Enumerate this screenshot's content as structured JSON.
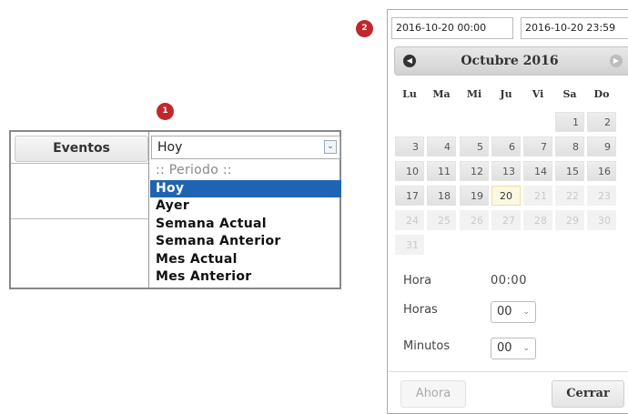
{
  "badges": {
    "one": "1",
    "two": "2"
  },
  "filter": {
    "eventos_label": "Eventos",
    "period_selected": "Hoy",
    "period_options": [
      "Periodo",
      "Hoy",
      "Ayer",
      "Semana Actual",
      "Semana Anterior",
      "Mes Actual",
      "Mes Anterior"
    ],
    "placeholder_display": ":: Periodo ::"
  },
  "datepicker": {
    "from_value": "2016-10-20 00:00",
    "to_value": "2016-10-20 23:59",
    "month_title": "Octubre 2016",
    "weekdays": [
      "Lu",
      "Ma",
      "Mi",
      "Ju",
      "Vi",
      "Sa",
      "Do"
    ],
    "prev_icon": "circle-arrow-left-icon",
    "next_icon": "circle-arrow-right-icon",
    "today": "20",
    "weeks": [
      [
        "",
        "",
        "",
        "",
        "",
        "1",
        "2"
      ],
      [
        "3",
        "4",
        "5",
        "6",
        "7",
        "8",
        "9"
      ],
      [
        "10",
        "11",
        "12",
        "13",
        "14",
        "15",
        "16"
      ],
      [
        "17",
        "18",
        "19",
        "20",
        "21",
        "22",
        "23"
      ],
      [
        "24",
        "25",
        "26",
        "27",
        "28",
        "29",
        "30"
      ],
      [
        "31",
        "",
        "",
        "",
        "",
        "",
        ""
      ]
    ],
    "disabled_from_day": 21,
    "hora_label": "Hora",
    "hora_value": "00:00",
    "horas_label": "Horas",
    "horas_value": "00",
    "minutos_label": "Minutos",
    "minutos_value": "00",
    "ahora_label": "Ahora",
    "cerrar_label": "Cerrar"
  },
  "colors": {
    "badge": "#c0282c",
    "selected_option": "#1f64b3",
    "today_cell": "#fbf8e2"
  }
}
